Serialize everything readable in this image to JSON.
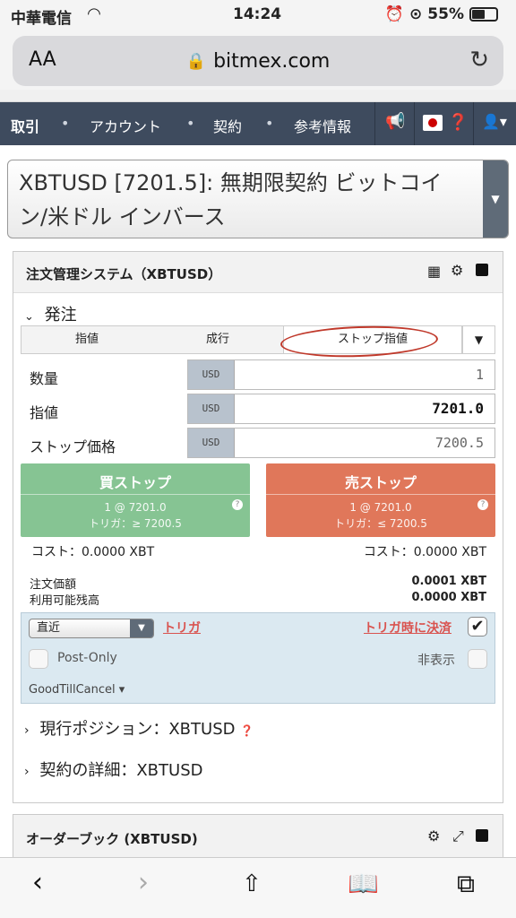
{
  "status": {
    "carrier": "中華電信",
    "time": "14:24",
    "battery": "55%"
  },
  "browser": {
    "aa": "AA",
    "url": "bitmex.com"
  },
  "nav": {
    "items": [
      "取引",
      "アカウント",
      "契約",
      "参考情報"
    ]
  },
  "symbol": {
    "text": "XBTUSD [7201.5]: 無期限契約 ビットコイン/米ドル インバース"
  },
  "panel": {
    "title": "注文管理システム（XBTUSD）",
    "section": "発注",
    "tabs": [
      "指値",
      "成行",
      "ストップ指値"
    ],
    "active_tab": "ストップ指値",
    "fields": [
      {
        "label": "数量",
        "unit": "USD",
        "value": "1"
      },
      {
        "label": "指値",
        "unit": "USD",
        "value": "7201.0"
      },
      {
        "label": "ストップ価格",
        "unit": "USD",
        "value": "7200.5"
      }
    ],
    "buy": {
      "title": "買ストップ",
      "line1": "1 @ 7201.0",
      "line2": "トリガ：≥ 7200.5",
      "cost": "コスト：0.0000 XBT"
    },
    "sell": {
      "title": "売ストップ",
      "line1": "1 @ 7201.0",
      "line2": "トリガ：≤ 7200.5",
      "cost": "コスト：0.0000 XBT"
    },
    "order_value_label": "注文価額",
    "order_value": "0.0001 XBT",
    "available_label": "利用可能残高",
    "available": "0.0000 XBT",
    "exec": {
      "trigger_select": "直近",
      "trigger_link": "トリガ",
      "close_on_trigger": "トリガ時に決済",
      "post_only": "Post-Only",
      "hidden": "非表示",
      "tif": "GoodTillCancel"
    },
    "position": "現行ポジション：XBTUSD",
    "contract": "契約の詳細：XBTUSD"
  },
  "orderbook": {
    "title": "オーダーブック (XBTUSD)"
  },
  "colors": {
    "nav": "#3e4b5e",
    "buy": "#86c493",
    "sell": "#e0775a",
    "exec_bg": "#dbe9f1",
    "annotation": "#c0392b"
  }
}
